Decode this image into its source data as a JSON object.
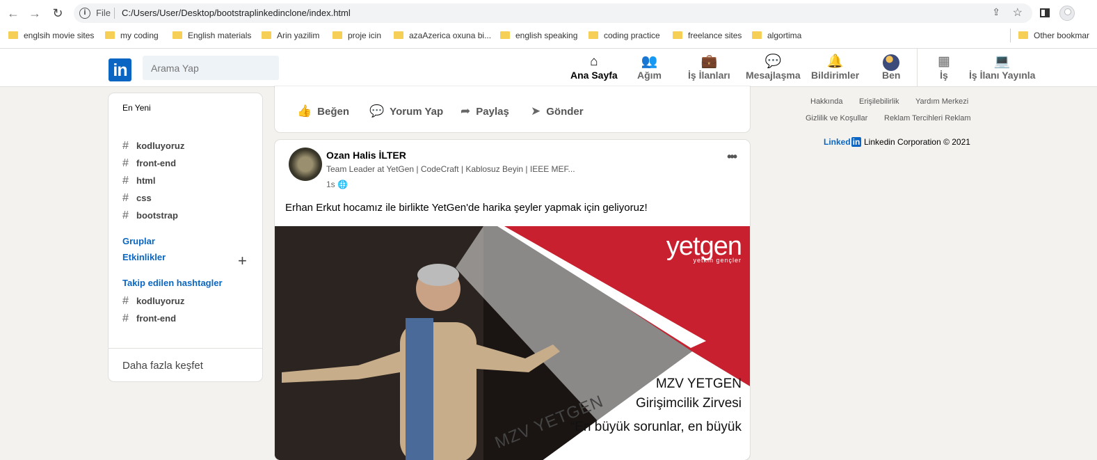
{
  "browser": {
    "file_label": "File",
    "url": "C:/Users/User/Desktop/bootstraplinkedinclone/index.html",
    "bookmarks": [
      "englsih movie sites",
      "my coding",
      "English materials",
      "Arin yazilim",
      "proje icin",
      "azaAzerica oxuna bi...",
      "english speaking",
      "coding practice",
      "freelance sites",
      "algortima"
    ],
    "other_bookmarks": "Other bookmar"
  },
  "header": {
    "logo": "in",
    "search_placeholder": "Arama Yap",
    "nav": [
      {
        "label": "Ana Sayfa",
        "icon": "home-icon",
        "active": true
      },
      {
        "label": "Ağım",
        "icon": "network-icon"
      },
      {
        "label": "İş İlanları",
        "icon": "briefcase-icon"
      },
      {
        "label": "Mesajlaşma",
        "icon": "message-icon"
      },
      {
        "label": "Bildirimler",
        "icon": "bell-icon"
      },
      {
        "label": "Ben",
        "icon": "avatar"
      },
      {
        "label": "İş",
        "icon": "grid-icon"
      },
      {
        "label": "İş İlanı Yayınla",
        "icon": "laptop-icon"
      }
    ]
  },
  "left": {
    "recent": "En Yeni",
    "tags": [
      "kodluyoruz",
      "front-end",
      "html",
      "css",
      "bootstrap"
    ],
    "groups": "Gruplar",
    "events": "Etkinlikler",
    "followed": "Takip edilen hashtagler",
    "followed_tags": [
      "kodluyoruz",
      "front-end"
    ],
    "more": "Daha fazla keşfet"
  },
  "actions": [
    "Beğen",
    "Yorum Yap",
    "Paylaş",
    "Gönder"
  ],
  "post": {
    "author": "Ozan Halis İLTER",
    "headline": "Team Leader at YetGen | CodeCraft | Kablosuz Beyin | IEEE MEF...",
    "time": "1s",
    "text": "Erhan Erkut hocamız ile birlikte YetGen'de harika şeyler yapmak için geliyoruz!",
    "image": {
      "logo": "yetgen",
      "logo_sub": "yetkin gençler",
      "title1": "MZV YETGEN",
      "title2": "Girişimcilik Zirvesi",
      "quote": "“En büyük sorunlar, en büyük",
      "bg_text": "MZV YETGEN"
    }
  },
  "footer": {
    "links": [
      "Hakkında",
      "Erişilebilirlik",
      "Yardım Merkezi",
      "Gizlilik ve Koşullar",
      "Reklam Tercihleri Reklam"
    ],
    "brand": "Linked",
    "brand_in": "in",
    "copyright": "Linkedin Corporation © 2021"
  }
}
